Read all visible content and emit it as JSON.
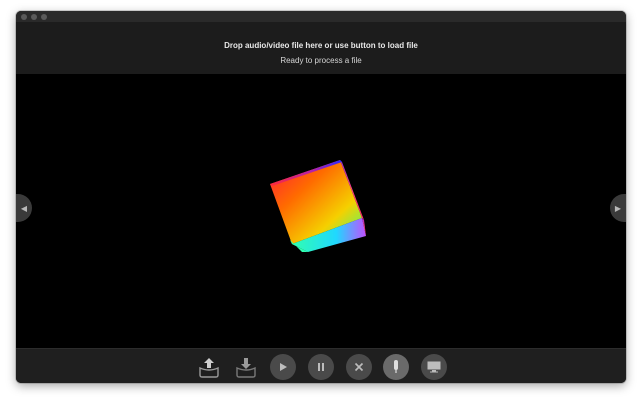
{
  "header": {
    "drop_text": "Drop audio/video file here or use button to load file",
    "status_text": "Ready to process a file"
  },
  "icons": {
    "load": "upload-icon",
    "save": "download-icon",
    "play": "play-icon",
    "pause": "pause-icon",
    "stop": "close-icon",
    "mic": "microphone-icon",
    "screen": "monitor-icon",
    "prev": "chevron-left-icon",
    "next": "chevron-right-icon"
  },
  "colors": {
    "window_bg": "#000000",
    "header_bg": "#1c1c1c",
    "toolbar_bg": "#1f1f1f",
    "button_bg": "#4a4a4a"
  }
}
